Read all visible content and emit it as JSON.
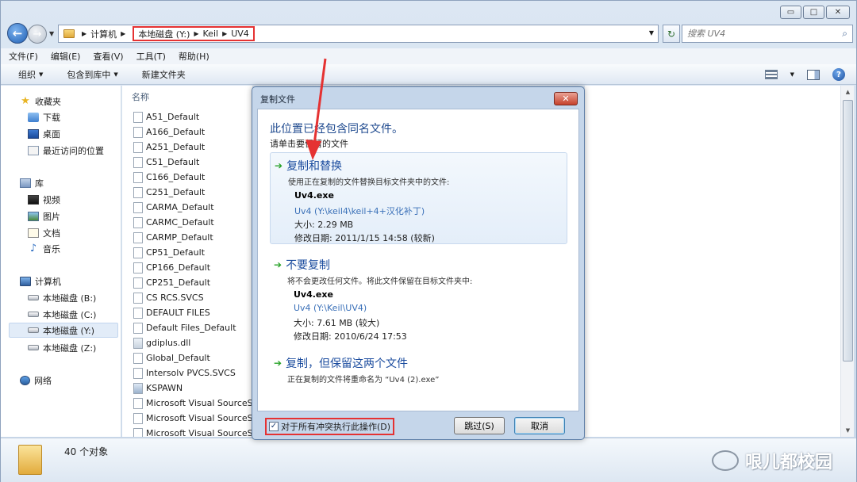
{
  "window": {
    "caption_buttons": {
      "minimize": "▭",
      "maximize": "□",
      "close": "✕"
    }
  },
  "address": {
    "crumbs_plain": [
      "计算机"
    ],
    "crumbs_highlighted": [
      "本地磁盘 (Y:)",
      "Keil",
      "UV4"
    ],
    "search_placeholder": "搜索 UV4"
  },
  "menu": [
    "文件(F)",
    "编辑(E)",
    "查看(V)",
    "工具(T)",
    "帮助(H)"
  ],
  "toolbar": {
    "organize": "组织",
    "include_library": "包含到库中",
    "new_folder": "新建文件夹"
  },
  "navpane": {
    "favorites": {
      "label": "收藏夹",
      "items": [
        "下载",
        "桌面",
        "最近访问的位置"
      ]
    },
    "libraries": {
      "label": "库",
      "items": [
        "视频",
        "图片",
        "文档",
        "音乐"
      ]
    },
    "computer": {
      "label": "计算机",
      "items": [
        "本地磁盘 (B:)",
        "本地磁盘 (C:)",
        "本地磁盘 (Y:)",
        "本地磁盘 (Z:)"
      ]
    },
    "network": {
      "label": "网络"
    }
  },
  "filelist": {
    "column_name": "名称",
    "files": [
      "A51_Default",
      "A166_Default",
      "A251_Default",
      "C51_Default",
      "C166_Default",
      "C251_Default",
      "CARMA_Default",
      "CARMC_Default",
      "CARMP_Default",
      "CP51_Default",
      "CP166_Default",
      "CP251_Default",
      "CS RCS.SVCS",
      "DEFAULT FILES",
      "Default Files_Default",
      "gdiplus.dll",
      "Global_Default",
      "Intersolv PVCS.SVCS",
      "KSPAWN",
      "Microsoft Visual SourceS",
      "Microsoft Visual SourceS",
      "Microsoft Visual SourceS"
    ]
  },
  "details": {
    "count": "40 个对象",
    "watermark": "哏儿都校园"
  },
  "dialog": {
    "title": "复制文件",
    "heading": "此位置已经包含同名文件。",
    "subheading": "请单击要保留的文件",
    "options": [
      {
        "title": "复制和替换",
        "desc": "使用正在复制的文件替换目标文件夹中的文件:",
        "file_name": "Uv4.exe",
        "file_path": "Uv4 (Y:\\keil4\\keil+4+汉化补丁)",
        "size": "大小: 2.29 MB",
        "modified": "修改日期: 2011/1/15 14:58 (较新)"
      },
      {
        "title": "不要复制",
        "desc": "将不会更改任何文件。将此文件保留在目标文件夹中:",
        "file_name": "Uv4.exe",
        "file_path": "Uv4 (Y:\\Keil\\UV4)",
        "size": "大小: 7.61 MB (较大)",
        "modified": "修改日期: 2010/6/24 17:53"
      },
      {
        "title": "复制，但保留这两个文件",
        "desc": "正在复制的文件将重命名为 “Uv4 (2).exe”"
      }
    ],
    "checkbox_label": "对于所有冲突执行此操作(D)",
    "checkbox_checked": true,
    "skip_button": "跳过(S)",
    "cancel_button": "取消"
  },
  "colors": {
    "highlight_red": "#e53232",
    "link_blue": "#1a4b9e",
    "green_arrow": "#2aa32a"
  }
}
